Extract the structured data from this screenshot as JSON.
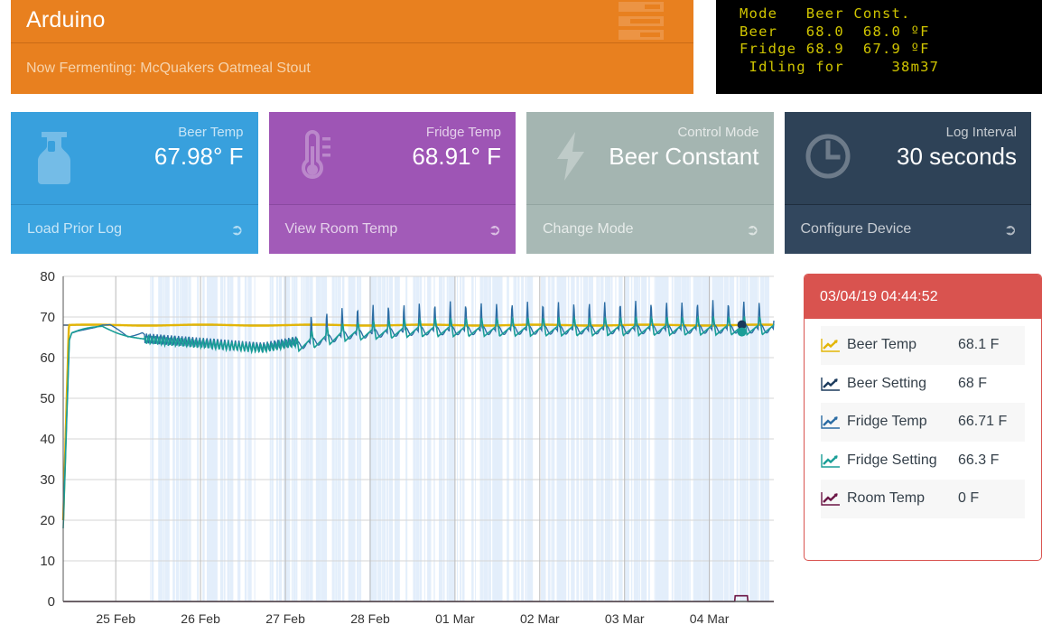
{
  "header": {
    "title": "Arduino",
    "subtitle": "Now Fermenting: McQuakers Oatmeal Stout",
    "menu_icon": "hamburger-menu-icon",
    "bg_color": "#e8801f"
  },
  "lcd": {
    "line1": "Mode   Beer Const.",
    "line2": "Beer   68.0  68.0 ºF",
    "line3": "Fridge 68.9  67.9 ºF",
    "line4": " Idling for     38m37",
    "text_color": "#cfc400",
    "bg_color": "#000000"
  },
  "cards": [
    {
      "label": "Beer Temp",
      "value": "67.98° F",
      "action": "Load Prior Log",
      "icon": "carboy-icon",
      "color": "#38a0dd",
      "theme": "blue"
    },
    {
      "label": "Fridge Temp",
      "value": "68.91° F",
      "action": "View Room Temp",
      "icon": "thermometer-icon",
      "color": "#9e55b5",
      "theme": "purple"
    },
    {
      "label": "Control Mode",
      "value": "Beer Constant",
      "action": "Change Mode",
      "icon": "lightning-bolt-icon",
      "color": "#a4b5b1",
      "theme": "gray"
    },
    {
      "label": "Log Interval",
      "value": "30 seconds",
      "action": "Configure Device",
      "icon": "clock-icon",
      "color": "#2e4257",
      "theme": "navy"
    }
  ],
  "tooltip": {
    "timestamp": "03/04/19 04:44:52",
    "header_color": "#d9534f",
    "rows": [
      {
        "icon": "line-chart-icon",
        "name": "Beer Temp",
        "value": "68.1 F",
        "color": "#e3b505"
      },
      {
        "icon": "line-chart-icon",
        "name": "Beer Setting",
        "value": "68 F",
        "color": "#1b3a5c"
      },
      {
        "icon": "line-chart-icon",
        "name": "Fridge Temp",
        "value": "66.71 F",
        "color": "#2b6ca3"
      },
      {
        "icon": "line-chart-icon",
        "name": "Fridge Setting",
        "value": "66.3 F",
        "color": "#1a9e97"
      },
      {
        "icon": "line-chart-icon",
        "name": "Room Temp",
        "value": "0 F",
        "color": "#6b1545"
      }
    ]
  },
  "chart_data": {
    "type": "line",
    "title": "",
    "xlabel": "",
    "ylabel": "",
    "ylim": [
      0,
      80
    ],
    "yticks": [
      0,
      10,
      20,
      30,
      40,
      50,
      60,
      70,
      80
    ],
    "grid": true,
    "legend_position": "external-tooltip",
    "x": [
      "25 Feb",
      "26 Feb",
      "27 Feb",
      "28 Feb",
      "01 Mar",
      "02 Mar",
      "03 Mar",
      "04 Mar"
    ],
    "xticklabels": [
      "25 Feb",
      "26 Feb",
      "27 Feb",
      "28 Feb",
      "01 Mar",
      "02 Mar",
      "03 Mar",
      "04 Mar"
    ],
    "cursor": {
      "timestamp": "03/04/19 04:44:52",
      "x_fraction": 0.955
    },
    "series": [
      {
        "name": "Beer Temp",
        "color": "#e3b505",
        "note": "flat line near 68 F across full range",
        "values": [
          68.0,
          68.0,
          68.0,
          68.0,
          68.0,
          68.0,
          68.0,
          68.1
        ]
      },
      {
        "name": "Beer Setting",
        "color": "#1b3a5c",
        "note": "setpoint flat at 68 F",
        "values": [
          68,
          68,
          68,
          68,
          68,
          68,
          68,
          68
        ]
      },
      {
        "name": "Fridge Temp",
        "color": "#2b6ca3",
        "note": "oscillating saw-tooth, peaks to ~74, troughs ~60-66",
        "values": [
          61.5,
          62.5,
          66.0,
          67.5,
          68.5,
          68.8,
          69.0,
          66.71
        ]
      },
      {
        "name": "Fridge Setting",
        "color": "#1a9e97",
        "note": "tracks fridge temp with smaller amplitude",
        "values": [
          62.0,
          62.0,
          65.5,
          67.0,
          68.0,
          68.2,
          68.5,
          66.3
        ]
      },
      {
        "name": "Room Temp",
        "color": "#6b1545",
        "note": "flat at 0 F (sensor absent), small blip near 04 Mar",
        "values": [
          0,
          0,
          0,
          0,
          0,
          0,
          0,
          0
        ]
      }
    ]
  }
}
